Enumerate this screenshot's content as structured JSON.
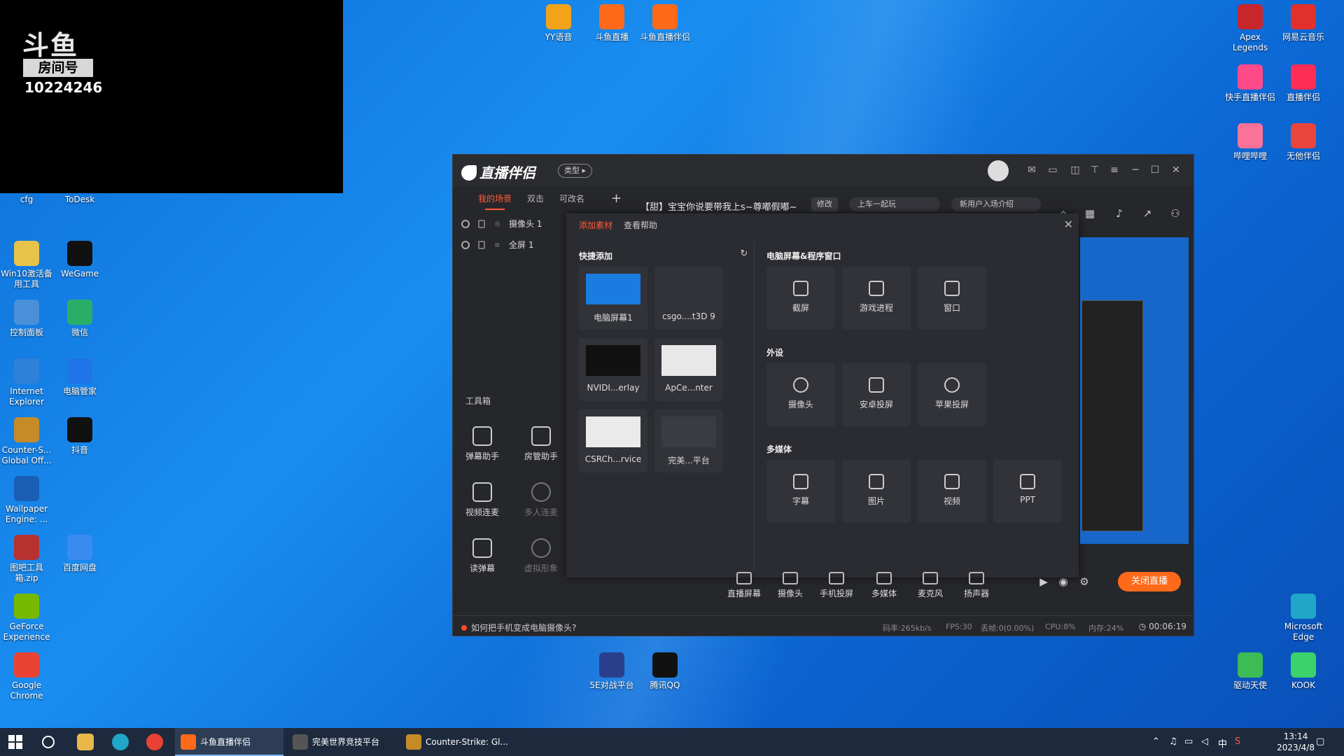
{
  "overlay": {
    "logo": "斗鱼",
    "room_label": "房间号",
    "room_number": "10224246"
  },
  "desktop_icons": [
    {
      "label": "YY语音",
      "color": "#f2a319"
    },
    {
      "label": "斗鱼直播",
      "color": "#ff6a1a"
    },
    {
      "label": "斗鱼直播伴侣",
      "color": "#ff6a1a"
    },
    {
      "label": "Apex Legends",
      "color": "#c8262d"
    },
    {
      "label": "网易云音乐",
      "color": "#e2302c"
    },
    {
      "label": "快手直播伴侣",
      "color": "#ff4a8a"
    },
    {
      "label": "直播伴侣",
      "color": "#ff2c55"
    },
    {
      "label": "哔哩哔哩",
      "color": "#fb7299"
    },
    {
      "label": "无他伴侣",
      "color": "#e8453c"
    },
    {
      "label": "cfg",
      "color": "#e8b84a"
    },
    {
      "label": "ToDesk",
      "color": "#2b6de8"
    },
    {
      "label": "Win10激活备用工具",
      "color": "#e8c34a"
    },
    {
      "label": "WeGame",
      "color": "#111111"
    },
    {
      "label": "控制面板",
      "color": "#4a90d9"
    },
    {
      "label": "微信",
      "color": "#2aae67"
    },
    {
      "label": "Internet Explorer",
      "color": "#2f80d8"
    },
    {
      "label": "电脑管家",
      "color": "#1e74e8"
    },
    {
      "label": "Counter-S... Global Off...",
      "color": "#c58b26"
    },
    {
      "label": "抖音",
      "color": "#111111"
    },
    {
      "label": "Wallpaper Engine: ...",
      "color": "#1a5fb4"
    },
    {
      "label": "图吧工具箱.zip",
      "color": "#b5322f"
    },
    {
      "label": "百度网盘",
      "color": "#3b8cf0"
    },
    {
      "label": "GeForce Experience",
      "color": "#76b900"
    },
    {
      "label": "Google Chrome",
      "color": "#e94235"
    },
    {
      "label": "5E对战平台",
      "color": "#2a3e8c"
    },
    {
      "label": "腾讯QQ",
      "color": "#111111"
    },
    {
      "label": "Microsoft Edge",
      "color": "#1fa6c9"
    },
    {
      "label": "驱动天使",
      "color": "#3dbb55"
    },
    {
      "label": "KOOK",
      "color": "#3cd26b"
    }
  ],
  "app": {
    "brand": "直播伴侣",
    "type_pill": "类型 ▸",
    "scene_tabs": [
      "我的场景",
      "双击",
      "可改名"
    ],
    "scene_add": "+",
    "room_title": "【甜】宝宝你说要带我上s~尊嘟假嘟~",
    "edit_label": "修改",
    "tag1": "上车一起玩",
    "tag2": "新用户入场介绍",
    "sources": [
      {
        "label": "摄像头 1"
      },
      {
        "label": "全屏 1"
      }
    ],
    "toolbox_title": "工具箱",
    "tools": [
      {
        "label": "弹幕助手"
      },
      {
        "label": "房管助手"
      },
      {
        "label": "视频连麦"
      },
      {
        "label": "多人连麦"
      },
      {
        "label": "读弹幕"
      },
      {
        "label": "虚拟形象"
      }
    ],
    "panel": {
      "tab_add": "添加素材",
      "tab_help": "查看帮助",
      "close": "✕",
      "quick_add_title": "快捷添加",
      "quick_items": [
        {
          "label": "电脑屏幕1"
        },
        {
          "label": "csgo....t3D 9"
        },
        {
          "label": "NVIDI...erlay"
        },
        {
          "label": "ApCe...nter"
        },
        {
          "label": "CSRCh...rvice"
        },
        {
          "label": "完美...平台"
        }
      ],
      "screen_title": "电脑屏幕&程序窗口",
      "screen_items": [
        {
          "label": "截屏"
        },
        {
          "label": "游戏进程"
        },
        {
          "label": "窗口"
        }
      ],
      "device_title": "外设",
      "device_items": [
        {
          "label": "摄像头"
        },
        {
          "label": "安卓投屏"
        },
        {
          "label": "苹果投屏"
        }
      ],
      "media_title": "多媒体",
      "media_items": [
        {
          "label": "字幕"
        },
        {
          "label": "图片"
        },
        {
          "label": "视频"
        },
        {
          "label": "PPT"
        }
      ]
    },
    "bottom_tools": [
      {
        "label": "直播屏幕"
      },
      {
        "label": "摄像头"
      },
      {
        "label": "手机投屏"
      },
      {
        "label": "多媒体"
      },
      {
        "label": "麦克风"
      },
      {
        "label": "扬声器"
      }
    ],
    "end_live": "关闭直播",
    "status": {
      "tip": "如何把手机变成电脑摄像头?",
      "bitrate": "码率:265kb/s",
      "fps": "FPS:30",
      "dropped": "丢帧:0(0.00%)",
      "cpu": "CPU:8%",
      "memory": "内存:24%",
      "timer": "00:06:19"
    }
  },
  "taskbar": {
    "tasks": [
      {
        "label": "斗鱼直播伴侣",
        "color": "#ff6a1a"
      },
      {
        "label": "完美世界竞技平台",
        "color": "#333333"
      },
      {
        "label": "Counter-Strike: Gl...",
        "color": "#c58b26"
      }
    ],
    "ime": "中",
    "time": "13:14",
    "date": "2023/4/8"
  }
}
